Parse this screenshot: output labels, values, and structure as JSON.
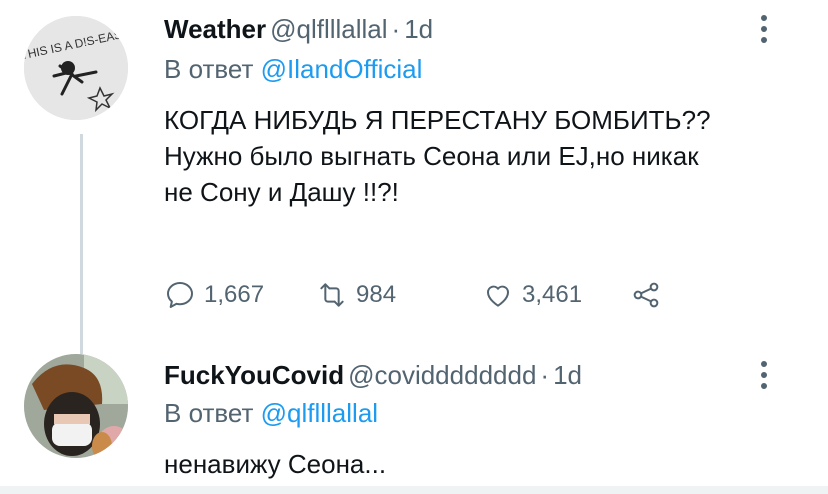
{
  "tweet1": {
    "name": "Weather",
    "handle": "@qlflllallal",
    "separator": "·",
    "time": "1d",
    "reply_prefix": "В ответ",
    "reply_to": "@IlandOfficial",
    "text": "КОГДА НИБУДЬ Я ПЕРЕСТАНУ БОМБИТЬ?? Нужно было выгнать Сеона или EJ,но никак не Сону и Дашу !!?!",
    "avatar_text": "THIS IS A D!S-EASE",
    "counts": {
      "replies": "1,667",
      "retweets": "984",
      "likes": "3,461"
    }
  },
  "tweet2": {
    "name": "FuckYouCovid",
    "handle": "@covidddddddd",
    "separator": "·",
    "time": "1d",
    "reply_prefix": "В ответ",
    "reply_to": "@qlflllallal",
    "text": "ненавижу Сеона..."
  },
  "colors": {
    "accent": "#1d9bf0",
    "muted": "#536471",
    "text": "#0f1419",
    "line": "#cfd9de"
  },
  "icons": [
    "reply-icon",
    "retweet-icon",
    "like-icon",
    "share-icon",
    "more-icon"
  ]
}
